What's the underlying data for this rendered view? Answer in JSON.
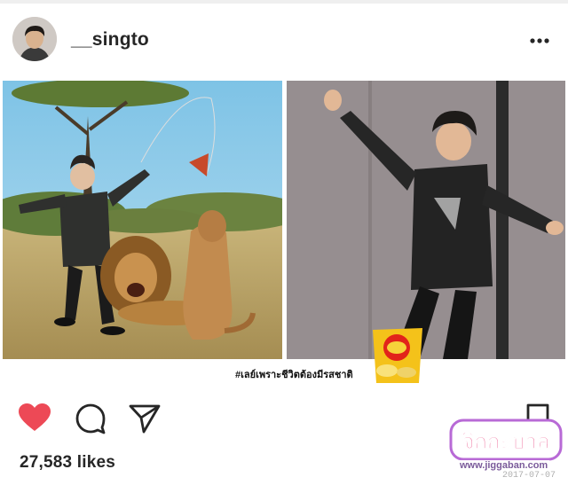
{
  "post": {
    "username": "__singto",
    "hashtag": "#เลย์เพราะชีวิตต้องมีรสชาติ",
    "likes": "27,583 likes",
    "liked": true
  },
  "icons": {
    "more": "more-options-icon",
    "like": "heart-icon",
    "comment": "comment-icon",
    "share": "send-icon",
    "save": "bookmark-icon"
  },
  "colors": {
    "like": "#ed4956",
    "text": "#262626",
    "divider": "#efefef"
  },
  "watermark": {
    "text": "จิกกะบาล",
    "url": "www.jiggaban.com",
    "date": "2017-07-07"
  }
}
